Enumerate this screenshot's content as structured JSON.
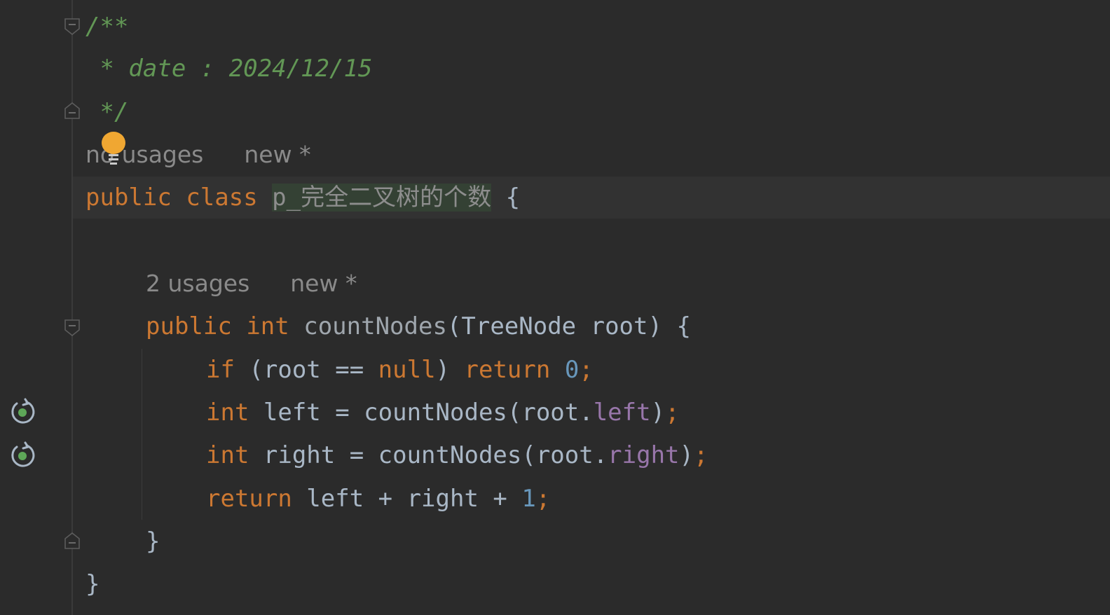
{
  "comment": {
    "open": "/**",
    "date_line": " * date : 2024/12/15",
    "close": " */"
  },
  "class_hint": {
    "usages": "no usages",
    "new": "new *"
  },
  "class_decl": {
    "public": "public",
    "class": "class",
    "name": "p_完全二叉树的个数",
    "brace": "{"
  },
  "method_hint": {
    "usages": "2 usages",
    "new": "new *"
  },
  "method_decl": {
    "public": "public",
    "int": "int",
    "name": "countNodes",
    "params": "(TreeNode root) {"
  },
  "body": {
    "line1": {
      "if": "if",
      "cond": " (root == ",
      "null": "null",
      "paren": ") ",
      "return": "return",
      "zero": "0",
      "semi": ";"
    },
    "line2": {
      "int": "int",
      "mid": " left = countNodes(root.",
      "field": "left",
      "close": ")",
      "semi": ";"
    },
    "line3": {
      "int": "int",
      "mid": " right = countNodes(root.",
      "field": "right",
      "close": ")",
      "semi": ";"
    },
    "line4": {
      "return": "return",
      "mid": " left + right + ",
      "one": "1",
      "semi": ";"
    }
  },
  "method_close": "}",
  "class_close": "}",
  "icons": {
    "fold": "fold-marker-icon",
    "recursive": "recursive-call-icon",
    "bulb": "intention-bulb-icon"
  },
  "colors": {
    "background": "#2b2b2b",
    "keyword": "#cc7832",
    "comment": "#629755",
    "number": "#6897bb",
    "field": "#9876aa",
    "text": "#a9b7c6",
    "bulb": "#f0a732",
    "recursive_dot": "#5ea758"
  }
}
